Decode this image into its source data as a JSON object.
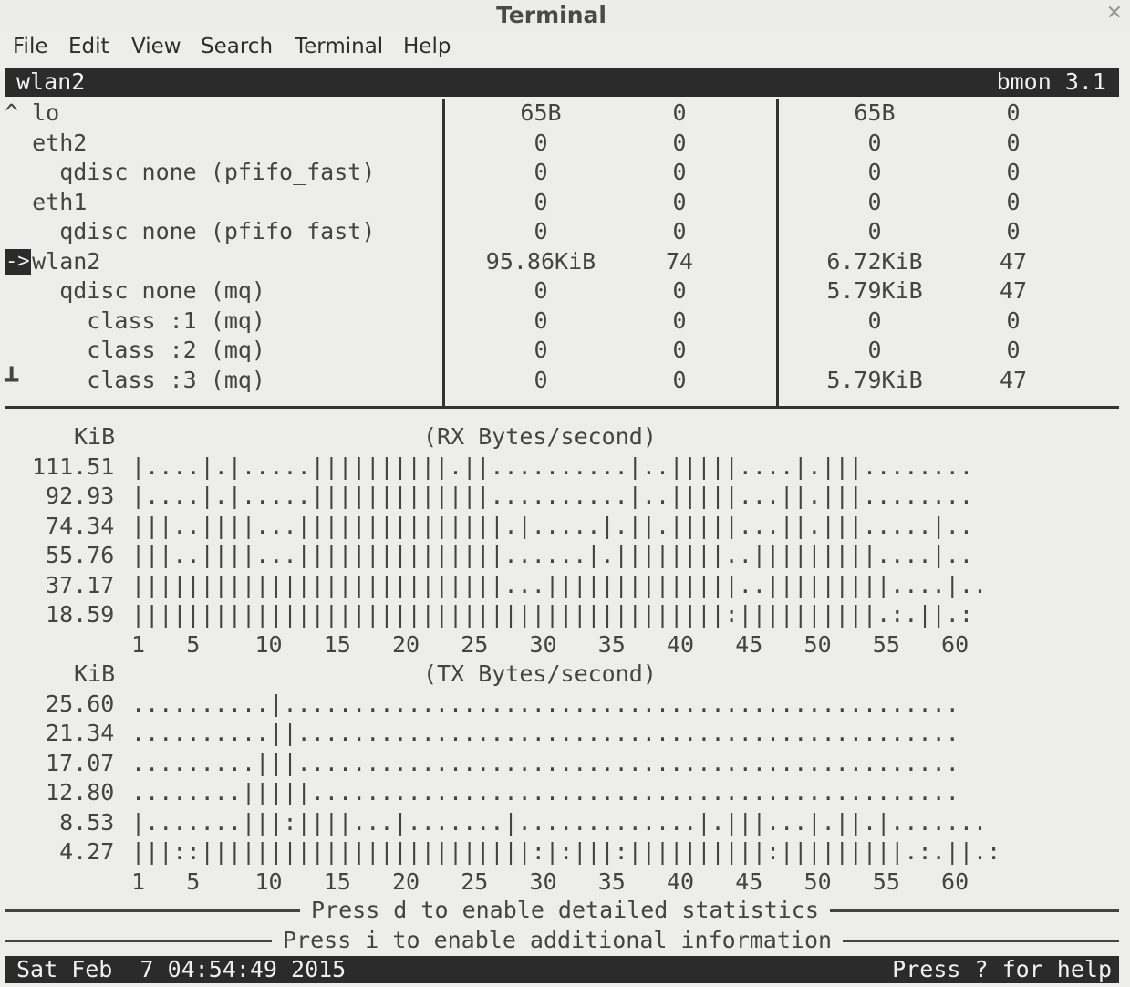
{
  "window": {
    "title": "Terminal",
    "close_icon": "✕"
  },
  "menu": [
    "File",
    "Edit",
    "View",
    "Search",
    "Terminal",
    "Help"
  ],
  "header": {
    "left": "wlan2",
    "right": "bmon 3.1"
  },
  "interfaces": [
    {
      "name": "^ lo",
      "rx_bytes": "65B",
      "rx_pkts": "0",
      "tx_bytes": "65B",
      "tx_pkts": "0"
    },
    {
      "name": "  eth2",
      "rx_bytes": "0",
      "rx_pkts": "0",
      "tx_bytes": "0",
      "tx_pkts": "0"
    },
    {
      "name": "    qdisc none (pfifo_fast)",
      "rx_bytes": "0",
      "rx_pkts": "0",
      "tx_bytes": "0",
      "tx_pkts": "0"
    },
    {
      "name": "  eth1",
      "rx_bytes": "0",
      "rx_pkts": "0",
      "tx_bytes": "0",
      "tx_pkts": "0"
    },
    {
      "name": "    qdisc none (pfifo_fast)",
      "rx_bytes": "0",
      "rx_pkts": "0",
      "tx_bytes": "0",
      "tx_pkts": "0"
    },
    {
      "name": "  wlan2",
      "selected": true,
      "rx_bytes": "95.86KiB",
      "rx_pkts": "74",
      "tx_bytes": "6.72KiB",
      "tx_pkts": "47"
    },
    {
      "name": "    qdisc none (mq)",
      "rx_bytes": "0",
      "rx_pkts": "0",
      "tx_bytes": "5.79KiB",
      "tx_pkts": "47"
    },
    {
      "name": "      class :1 (mq)",
      "rx_bytes": "0",
      "rx_pkts": "0",
      "tx_bytes": "0",
      "tx_pkts": "0"
    },
    {
      "name": "      class :2 (mq)",
      "rx_bytes": "0",
      "rx_pkts": "0",
      "tx_bytes": "0",
      "tx_pkts": "0"
    },
    {
      "name": "┻     class :3 (mq)",
      "rx_bytes": "0",
      "rx_pkts": "0",
      "tx_bytes": "5.79KiB",
      "tx_pkts": "47"
    }
  ],
  "selected_marker": "->",
  "graphs": [
    {
      "unit": "KiB",
      "title": "(RX Bytes/second)",
      "rows": [
        {
          "label": "111.51",
          "bars": "|....|.|.....||||||||||.||..........|..|||||....|.|||........"
        },
        {
          "label": " 92.93",
          "bars": "|....|.|.....|||||||||||||..........|..|||||...||.|||........"
        },
        {
          "label": " 74.34",
          "bars": "|||..||||...|||||||||||||||.|.....|.||.|||||...||.|||.....|.."
        },
        {
          "label": " 55.76",
          "bars": "|||..||||...|||||||||||||||......|.||||||||..|||||||||....|.."
        },
        {
          "label": " 37.17",
          "bars": "|||||||||||||||||||||||||||...||||||||||||||..|||||||||....|.."
        },
        {
          "label": " 18.59",
          "bars": "|||||||||||||||||||||||||||||||||||||||||||:||||||||||.:.||.:"
        }
      ],
      "axis": "1   5    10   15   20   25   30   35   40   45   50   55   60"
    },
    {
      "unit": "KiB",
      "title": "(TX Bytes/second)",
      "rows": [
        {
          "label": " 25.60",
          "bars": "..........|................................................."
        },
        {
          "label": " 21.34",
          "bars": "..........||................................................"
        },
        {
          "label": " 17.07",
          "bars": ".........|||................................................"
        },
        {
          "label": " 12.80",
          "bars": "........|||||..............................................."
        },
        {
          "label": "  8.53",
          "bars": "|.......|||:||||...|.......|.............|.|||...|.||.|......."
        },
        {
          "label": "  4.27",
          "bars": "|||::||||||||||||||||||||||||:|:|||:||||||||||:|||||||||.:.||.:"
        }
      ],
      "axis": "1   5    10   15   20   25   30   35   40   45   50   55   60"
    }
  ],
  "messages": [
    "Press d to enable detailed statistics",
    "Press i to enable additional information"
  ],
  "statusbar": {
    "left": "Sat Feb  7 04:54:49 2015",
    "right": "Press ? for help"
  }
}
